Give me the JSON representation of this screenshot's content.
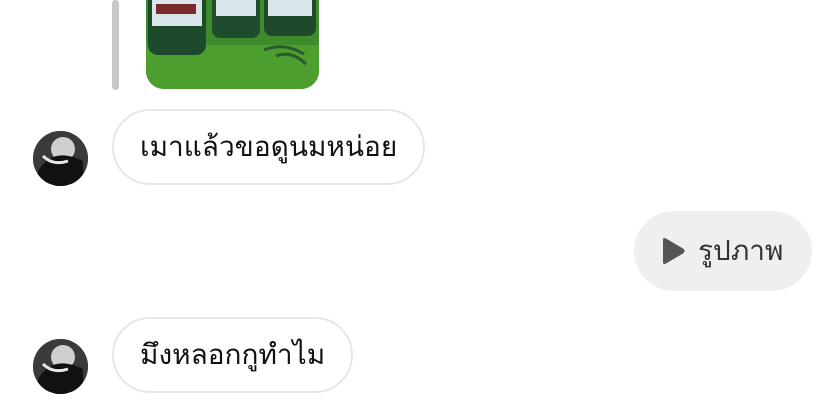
{
  "messages": [
    {
      "text": "เมาแล้วขอดูนมหน่อย"
    },
    {
      "text": "รูปภาพ"
    },
    {
      "text": "มึงหลอกกูทำไม"
    }
  ],
  "icons": {
    "avatar": "avatar",
    "play": "play-icon",
    "photo": "photo-attachment"
  }
}
